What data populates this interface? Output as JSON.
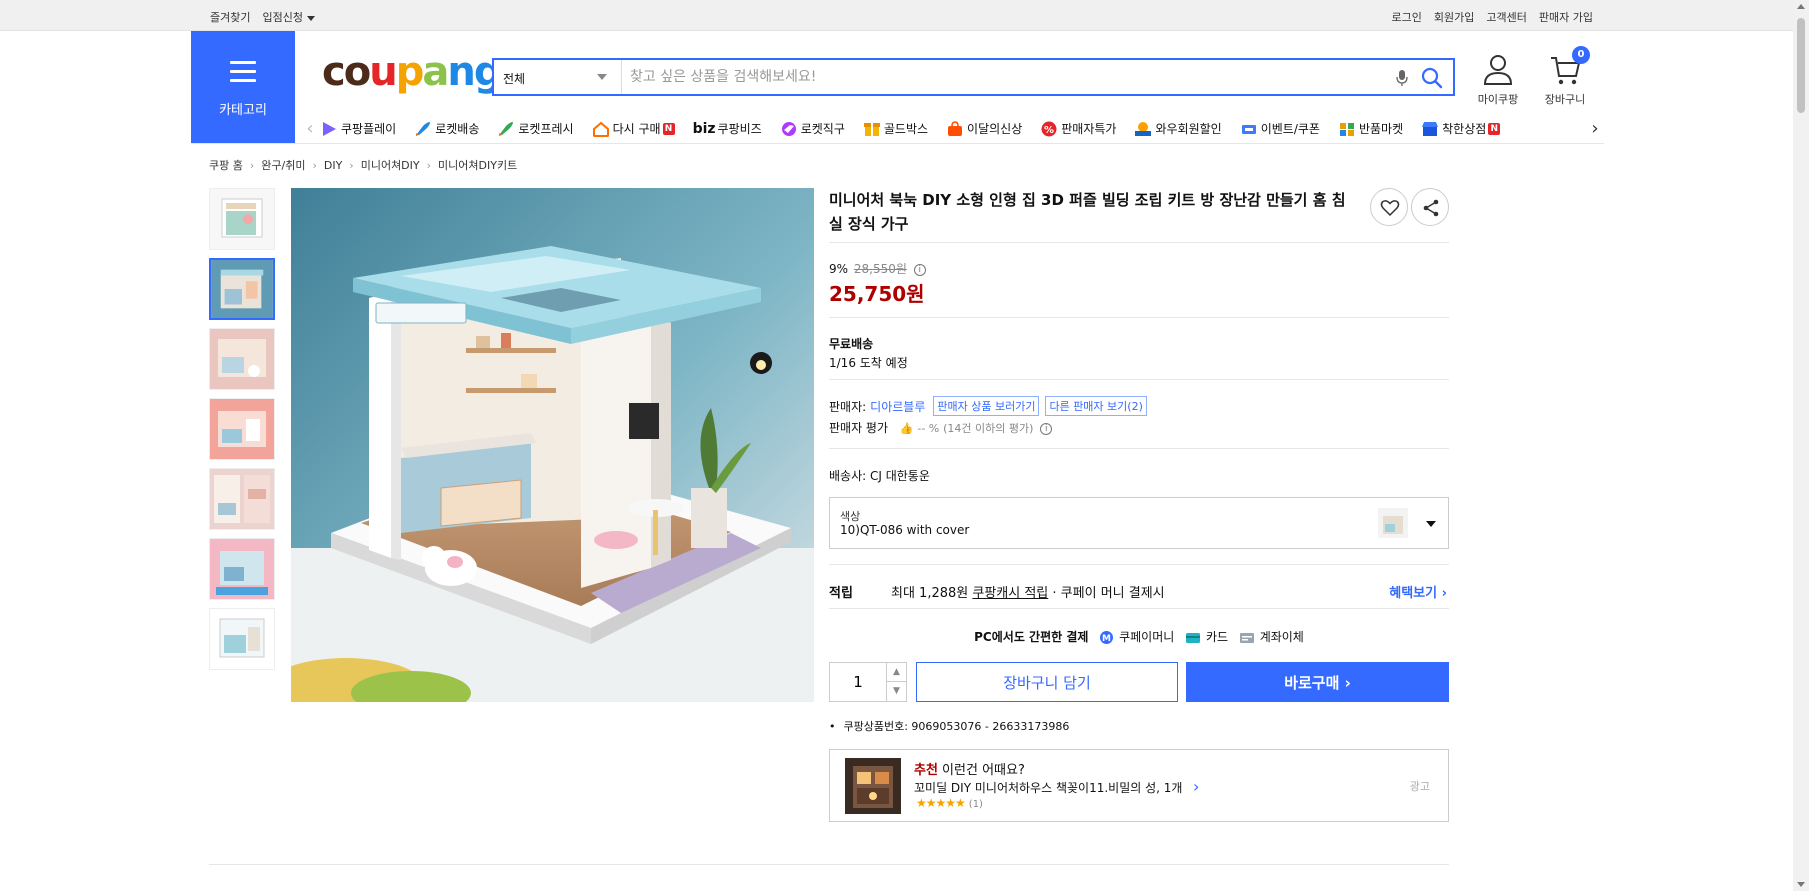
{
  "topbar": {
    "left": [
      "즐겨찾기",
      "입점신청"
    ],
    "right": [
      "로그인",
      "회원가입",
      "고객센터",
      "판매자 가입"
    ]
  },
  "header": {
    "category_label": "카테고리",
    "logo_text": "coupang",
    "search": {
      "scope": "전체",
      "placeholder": "찾고 싶은 상품을 검색해보세요!"
    },
    "mycoupang_label": "마이쿠팡",
    "cart_label": "장바구니",
    "cart_count": "0"
  },
  "nav": {
    "items": [
      {
        "label": "쿠팡플레이",
        "icon": "play-icon",
        "color": "#7b61ff"
      },
      {
        "label": "로켓배송",
        "icon": "rocket-icon",
        "color": "#1e88e5"
      },
      {
        "label": "로켓프레시",
        "icon": "rocket-fresh-icon",
        "color": "#34a853"
      },
      {
        "label": "다시 구매",
        "icon": "home-icon",
        "color": "#ff6f00",
        "badge": "N"
      },
      {
        "label": "쿠팡비즈",
        "icon": "biz-icon",
        "prefix": "biz"
      },
      {
        "label": "로켓직구",
        "icon": "globe-icon",
        "color": "#b039ff"
      },
      {
        "label": "골드박스",
        "icon": "goldbox-icon",
        "color": "#f5b400"
      },
      {
        "label": "이달의신상",
        "icon": "bag-icon",
        "color": "#ff4e00"
      },
      {
        "label": "판매자특가",
        "icon": "percent-icon",
        "color": "#e52528"
      },
      {
        "label": "와우회원할인",
        "icon": "wow-icon",
        "color": "#1565c0"
      },
      {
        "label": "이벤트/쿠폰",
        "icon": "coupon-icon",
        "color": "#3e7bfa"
      },
      {
        "label": "반품마켓",
        "icon": "market-icon",
        "color": "#e6a000"
      },
      {
        "label": "착한상점",
        "icon": "store-icon",
        "color": "#1a56db",
        "badge": "N"
      }
    ]
  },
  "breadcrumb": [
    "쿠팡 홈",
    "완구/취미",
    "DIY",
    "미니어쳐DIY",
    "미니어쳐DIY키트"
  ],
  "product": {
    "title": "미니어처 북눅 DIY 소형 인형 집 3D 퍼즐 빌딩 조립 키트 방 장난감 만들기 홈 침실 장식 가구",
    "discount_rate": "9%",
    "original_price": "28,550원",
    "price": "25,750원",
    "shipping_title": "무료배송",
    "arrival": "1/16 도착 예정",
    "seller_label": "판매자:",
    "seller_name": "디아르블루",
    "seller_products_btn": "판매자 상품 보러가기",
    "other_sellers_btn": "다른 판매자 보기(2)",
    "seller_rating_label": "판매자 평가",
    "seller_rating_value": "-- %",
    "seller_rating_note": "(14건 이하의 평가)",
    "carrier": "배송사:  CJ 대한통운",
    "option_key": "색상",
    "option_value": "10)QT-086 with cover",
    "reward_title": "적립",
    "reward_prefix": "최대 1,288원",
    "reward_link": "쿠팡캐시 적립",
    "reward_suffix": "· 쿠페이 머니 결제시",
    "reward_more": "혜택보기",
    "pay_title": "PC에서도 간편한 결제",
    "pay_methods": [
      "쿠페이머니",
      "카드",
      "계좌이체"
    ],
    "quantity": "1",
    "cart_btn": "장바구니 담기",
    "buy_btn": "바로구매",
    "product_id": "쿠팡상품번호: 9069053076 - 26633173986"
  },
  "recommend": {
    "prefix": "추천",
    "title_rest": " 이런건 어때요?",
    "name": "꼬미딜 DIY 미니어처하우스 책꽂이11.비밀의 성, 1개",
    "stars": "★★★★★",
    "rating": 5,
    "review_count": "(1)",
    "ad_label": "광고"
  },
  "colors": {
    "accent": "#346aff",
    "price": "#ae0000"
  }
}
